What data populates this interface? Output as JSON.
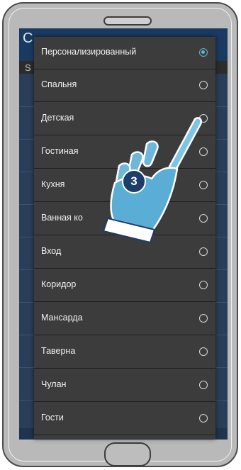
{
  "dialog": {
    "options": [
      {
        "label": "Персонализированный",
        "selected": true
      },
      {
        "label": "Спальня",
        "selected": false
      },
      {
        "label": "Детская",
        "selected": false
      },
      {
        "label": "Гостиная",
        "selected": false
      },
      {
        "label": "Кухня",
        "selected": false
      },
      {
        "label": "Ванная ко",
        "selected": false
      },
      {
        "label": "Вход",
        "selected": false
      },
      {
        "label": "Коридор",
        "selected": false
      },
      {
        "label": "Мансарда",
        "selected": false
      },
      {
        "label": "Таверна",
        "selected": false
      },
      {
        "label": "Чулан",
        "selected": false
      },
      {
        "label": "Гости",
        "selected": false
      }
    ]
  },
  "background": {
    "header_glyph": "C",
    "sub_glyph": "S"
  },
  "callout": {
    "step": "3",
    "hand_icon": "hand-pointer-icon"
  },
  "colors": {
    "accent": "#5fb6c9",
    "dialog_bg": "#3c3c3c",
    "badge": "#1d3d6b"
  }
}
